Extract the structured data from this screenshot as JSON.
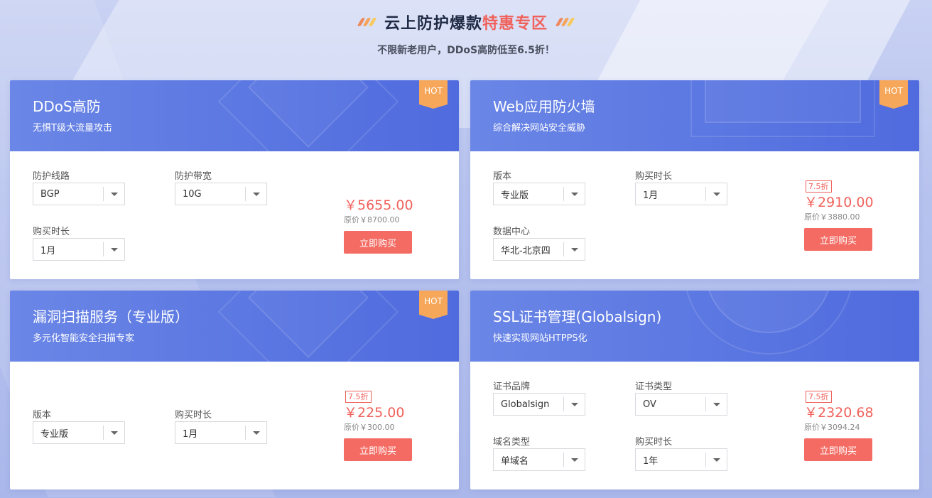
{
  "header": {
    "title_main": "云上防护爆款",
    "title_highlight": "特惠专区",
    "subtitle": "不限新老用户，DDoS高防低至6.5折！"
  },
  "hot_label": "HOT",
  "buy_label": "立即购买",
  "colors": {
    "accent": "#f0615b",
    "card_header": "#5a76e2",
    "hot_badge": "#f6a75a"
  },
  "cards": [
    {
      "title": "DDoS高防",
      "desc": "无惧T级大流量攻击",
      "hot": true,
      "fields": [
        {
          "label": "防护线路",
          "value": "BGP"
        },
        {
          "label": "防护带宽",
          "value": "10G"
        },
        {
          "label": "购买时长",
          "value": "1月"
        }
      ],
      "discount": "",
      "price": "￥5655.00",
      "original": "原价￥8700.00"
    },
    {
      "title": "Web应用防火墙",
      "desc": "综合解决网站安全威胁",
      "hot": true,
      "fields": [
        {
          "label": "版本",
          "value": "专业版"
        },
        {
          "label": "购买时长",
          "value": "1月"
        },
        {
          "label": "数据中心",
          "value": "华北-北京四"
        }
      ],
      "discount": "7.5折",
      "price": "￥2910.00",
      "original": "原价￥3880.00"
    },
    {
      "title": "漏洞扫描服务（专业版）",
      "desc": "多元化智能安全扫描专家",
      "hot": true,
      "fields": [
        {
          "label": "版本",
          "value": "专业版"
        },
        {
          "label": "购买时长",
          "value": "1月"
        }
      ],
      "discount": "7.5折",
      "price": "￥225.00",
      "original": "原价￥300.00"
    },
    {
      "title": "SSL证书管理(Globalsign)",
      "desc": "快速实现网站HTPPS化",
      "hot": false,
      "fields": [
        {
          "label": "证书品牌",
          "value": "Globalsign"
        },
        {
          "label": "证书类型",
          "value": "OV"
        },
        {
          "label": "域名类型",
          "value": "单域名"
        },
        {
          "label": "购买时长",
          "value": "1年"
        }
      ],
      "discount": "7.5折",
      "price": "￥2320.68",
      "original": "原价￥3094.24"
    }
  ]
}
